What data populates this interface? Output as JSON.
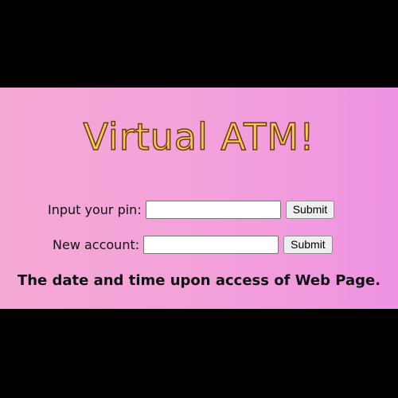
{
  "page": {
    "title": "Virtual ATM!",
    "background_color": "#000000",
    "panel_gradient": [
      "#f5a9d6",
      "#ef93e2"
    ],
    "title_color": "#f9c85a"
  },
  "pin_form": {
    "label": "Input your pin:",
    "input_value": "",
    "submit_label": "Submit"
  },
  "account_form": {
    "label": "New account:",
    "input_value": "",
    "submit_label": "Submit"
  },
  "status": {
    "text": "The date and time upon access of Web Page."
  }
}
